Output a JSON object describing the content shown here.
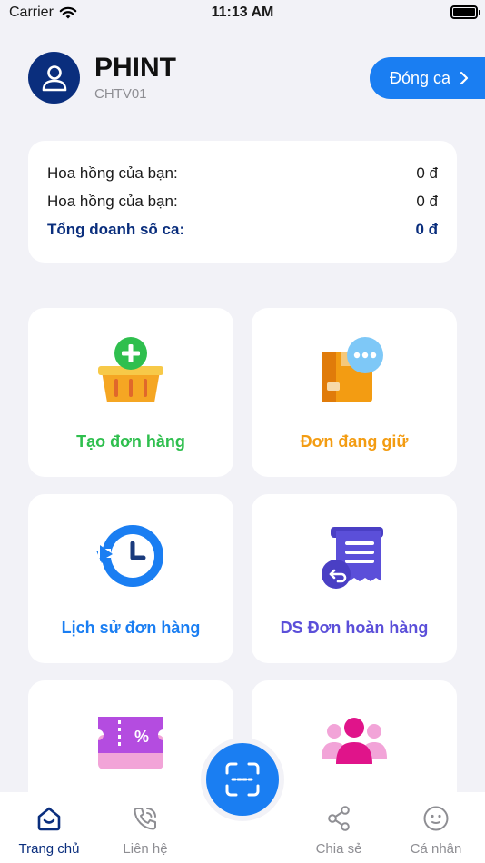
{
  "status_bar": {
    "carrier": "Carrier",
    "time": "11:13 AM"
  },
  "header": {
    "name": "PHINT",
    "code": "CHTV01",
    "close_shift_label": "Đóng ca"
  },
  "summary": {
    "rows": [
      {
        "label": "Hoa hồng của bạn:",
        "value": "0 đ"
      },
      {
        "label": "Hoa hồng của bạn:",
        "value": "0 đ"
      },
      {
        "label": "Tổng doanh số ca:",
        "value": "0 đ"
      }
    ]
  },
  "tiles": [
    {
      "label": "Tạo đơn hàng",
      "icon": "basket-add-icon",
      "color": "#2FBF4E"
    },
    {
      "label": "Đơn đang giữ",
      "icon": "package-chat-icon",
      "color": "#F39C12"
    },
    {
      "label": "Lịch sử đơn hàng",
      "icon": "history-clock-icon",
      "color": "#1A7EF2"
    },
    {
      "label": "DS Đơn hoàn hàng",
      "icon": "return-receipt-icon",
      "color": "#5B4FD9"
    },
    {
      "label": "",
      "icon": "discount-ticket-icon",
      "color": "#B44CE0"
    },
    {
      "label": "",
      "icon": "customers-group-icon",
      "color": "#E0148A"
    }
  ],
  "tabbar": {
    "items": [
      {
        "label": "Trang chủ",
        "icon": "home-icon",
        "active": true
      },
      {
        "label": "Liên hệ",
        "icon": "phone-icon",
        "active": false
      },
      {
        "label": "Chia sẻ",
        "icon": "share-icon",
        "active": false
      },
      {
        "label": "Cá nhân",
        "icon": "smile-icon",
        "active": false
      }
    ],
    "scan_icon": "scan-icon"
  },
  "colors": {
    "primary": "#1A7EF2",
    "navy": "#0A2E7D",
    "background": "#F2F2F7"
  }
}
